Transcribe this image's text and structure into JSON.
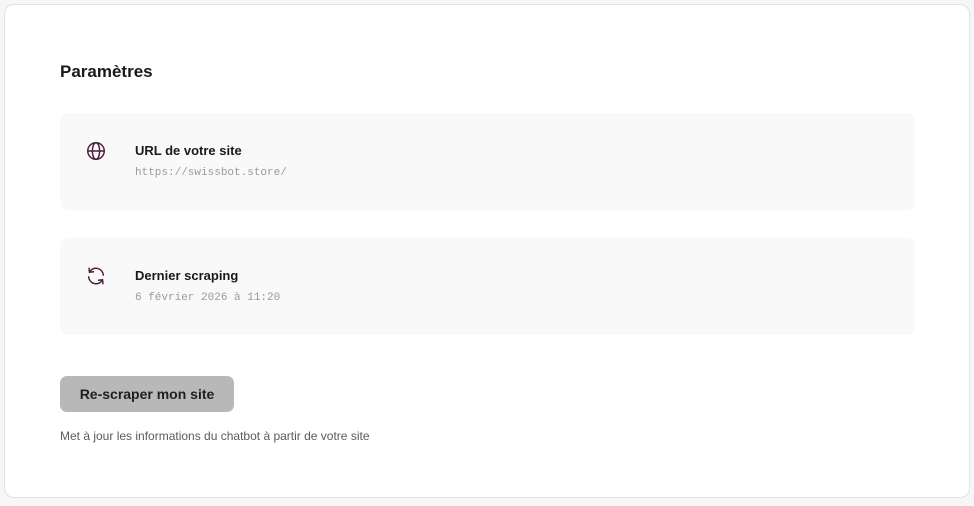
{
  "settings": {
    "title": "Paramètres",
    "items": [
      {
        "icon": "globe-icon",
        "label": "URL de votre site",
        "value": "https://swissbot.store/"
      },
      {
        "icon": "refresh-icon",
        "label": "Dernier scraping",
        "value": "6 février 2026 à 11:20"
      }
    ],
    "rescrape_label": "Re-scraper mon site",
    "help_text": "Met à jour les informations du chatbot à partir de votre site"
  },
  "colors": {
    "icon": "#4a1d3f",
    "button_bg": "#b8b8b8",
    "card_bg": "#f9f9f9"
  }
}
